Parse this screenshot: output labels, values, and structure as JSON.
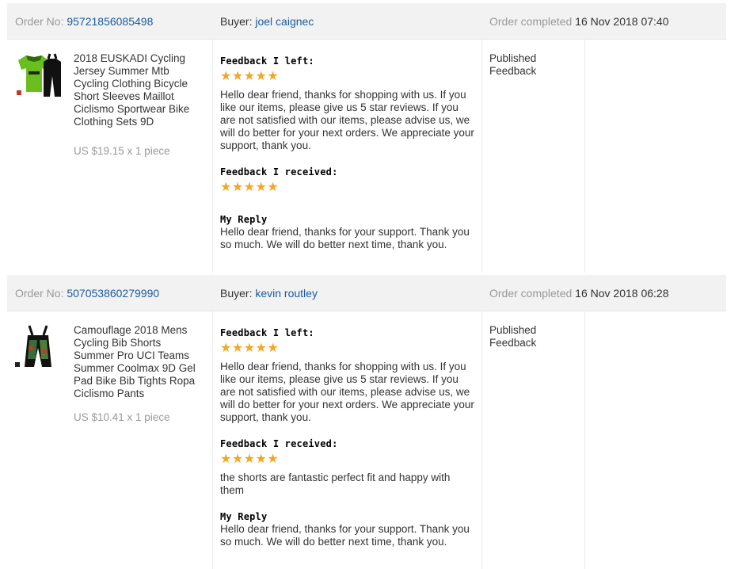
{
  "labels": {
    "order_no": "Order No:",
    "buyer": "Buyer:",
    "order_completed": "Order completed",
    "feedback_left": "Feedback I left:",
    "feedback_received": "Feedback I received:",
    "my_reply": "My Reply"
  },
  "colors": {
    "star": "#f5a623",
    "link": "#1a5a9e",
    "header_bg": "#f2f2f2"
  },
  "orders": [
    {
      "order_no": "95721856085498",
      "buyer": "joel caignec",
      "completed": "16 Nov 2018 07:40",
      "product_name": "2018 EUSKADI Cycling Jersey Summer Mtb Cycling Clothing Bicycle Short Sleeves Maillot Ciclismo Sportwear Bike Clothing Sets 9D",
      "price": "US $19.15 x 1 piece",
      "feedback_left_stars": "★★★★★",
      "feedback_left_text": "Hello dear friend, thanks for shopping with us. If you like our items, please give us 5 star reviews. If you are not satisfied with our items, please advise us, we will do better for your next orders. We appreciate your support, thank you.",
      "feedback_received_stars": "★★★★★",
      "feedback_received_text": "",
      "reply_text": "Hello dear friend, thanks for your support. Thank you so much. We will do better next time, thank you.",
      "status": "Published Feedback"
    },
    {
      "order_no": "507053860279990",
      "buyer": "kevin routley",
      "completed": "16 Nov 2018 06:28",
      "product_name": "Camouflage 2018 Mens Cycling Bib Shorts Summer Pro UCI Teams Summer Coolmax 9D Gel Pad Bike Bib Tights Ropa Ciclismo Pants",
      "price": "US $10.41 x 1 piece",
      "feedback_left_stars": "★★★★★",
      "feedback_left_text": "Hello dear friend, thanks for shopping with us. If you like our items, please give us 5 star reviews. If you are not satisfied with our items, please advise us, we will do better for your next orders. We appreciate your support, thank you.",
      "feedback_received_stars": "★★★★★",
      "feedback_received_text": "the shorts are fantastic perfect fit and happy with them",
      "reply_text": "Hello dear friend, thanks for your support. Thank you so much. We will do better next time, thank you.",
      "status": "Published Feedback"
    }
  ]
}
